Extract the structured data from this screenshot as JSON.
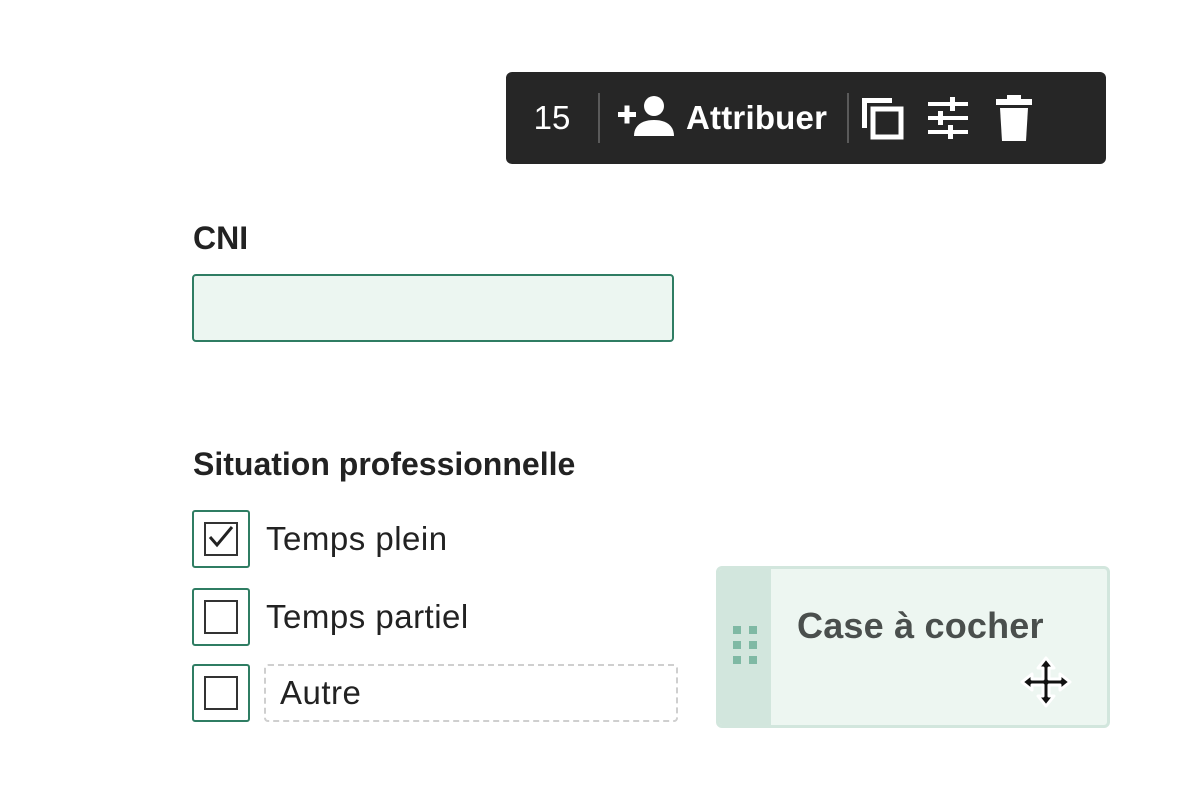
{
  "toolbar": {
    "page_number": "15",
    "assign_label": "Attribuer",
    "icons": [
      "user-plus-icon",
      "duplicate-icon",
      "settings-sliders-icon",
      "trash-icon"
    ]
  },
  "cni": {
    "label": "CNI",
    "value": ""
  },
  "situation": {
    "label": "Situation professionnelle",
    "options": [
      {
        "label": "Temps plein",
        "checked": true
      },
      {
        "label": "Temps partiel",
        "checked": false
      },
      {
        "label": "Autre",
        "checked": false,
        "editable": true
      }
    ]
  },
  "drag_chip": {
    "label": "Case à cocher"
  },
  "colors": {
    "toolbar_bg": "#262626",
    "accent_green": "#2f7d63",
    "input_fill": "#ecf6f1",
    "chip_fill": "#edf6f1",
    "chip_handle": "#d2e6dd"
  }
}
